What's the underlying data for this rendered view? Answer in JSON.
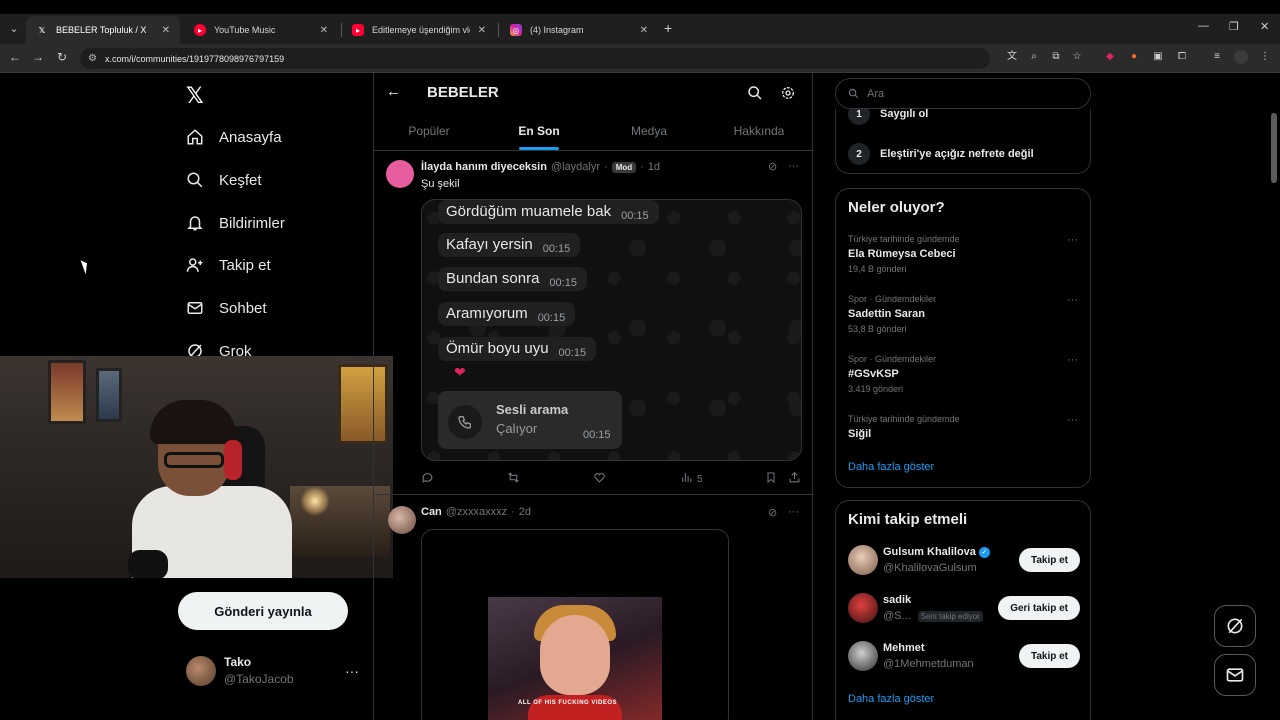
{
  "browser": {
    "tabs": [
      {
        "title": "BEBELER Topluluk / X",
        "favicon": "x-logo",
        "active": true
      },
      {
        "title": "YouTube Music",
        "favicon": "youtube-music-icon",
        "active": false
      },
      {
        "title": "Editlemeye üşendiğim vlog - Yo",
        "favicon": "youtube-icon",
        "active": false
      },
      {
        "title": "(4) Instagram",
        "favicon": "instagram-icon",
        "active": false
      }
    ],
    "url": "x.com/i/communities/1919778098976797159"
  },
  "nav": {
    "items": [
      "Anasayfa",
      "Keşfet",
      "Bildirimler",
      "Takip et",
      "Sohbet",
      "Grok"
    ],
    "post_button": "Gönderi yayınla",
    "profile": {
      "name": "Tako",
      "handle": "@TakoJacob"
    }
  },
  "community": {
    "title": "BEBELER",
    "tabs": [
      "Popüler",
      "En Son",
      "Medya",
      "Hakkında"
    ],
    "active_tab": "En Son"
  },
  "tweets": [
    {
      "name": "İlayda hanım diyeceksin",
      "handle": "@laydalyr",
      "badge": "Mod",
      "sep": "·",
      "time": "1d",
      "text": "Şu şekil",
      "chat": [
        {
          "msg": "Gördüğüm muamele bak",
          "time": "00:15"
        },
        {
          "msg": "Kafayı yersin",
          "time": "00:15"
        },
        {
          "msg": "Bundan sonra",
          "time": "00:15"
        },
        {
          "msg": "Aramıyorum",
          "time": "00:15"
        },
        {
          "msg": "Ömür boyu uyu",
          "time": "00:15"
        }
      ],
      "heart": "❤",
      "call": {
        "title": "Sesli arama",
        "status": "Çalıyor",
        "time": "00:15"
      },
      "views": "5"
    },
    {
      "name": "Can",
      "handle": "@zxxxaxxxz",
      "sep": "·",
      "time": "2d",
      "video_caption": "ALL OF HIS FUCKING VIDEOS"
    }
  ],
  "search": {
    "placeholder": "Ara"
  },
  "rules": [
    {
      "num": "1",
      "text": "Saygılı ol"
    },
    {
      "num": "2",
      "text": "Eleştiri'ye açığız nefrete değil"
    }
  ],
  "trends": {
    "title": "Neler oluyor?",
    "items": [
      {
        "context": "Türkiye tarihinde gündemde",
        "name": "Ela Rümeysa Cebeci",
        "count": "19,4 B gönderi"
      },
      {
        "context": "Spor · Gündemdekiler",
        "name": "Sadettin Saran",
        "count": "53,8 B gönderi"
      },
      {
        "context": "Spor · Gündemdekiler",
        "name": "#GSvKSP",
        "count": "3.419 gönderi"
      },
      {
        "context": "Türkiye tarihinde gündemde",
        "name": "Siğil",
        "count": ""
      }
    ],
    "show_more": "Daha fazla göster"
  },
  "who_to_follow": {
    "title": "Kimi takip etmeli",
    "users": [
      {
        "name": "Gulsum Khalilova",
        "handle": "@KhalilovaGulsum",
        "button": "Takip et",
        "verified": true
      },
      {
        "name": "sadik",
        "handle": "@S...",
        "follows_you": "Seni takip ediyor",
        "button": "Geri takip et"
      },
      {
        "name": "Mehmet",
        "handle": "@1Mehmetduman",
        "button": "Takip et"
      }
    ],
    "show_more": "Daha fazla göster"
  },
  "colors": {
    "accent": "#1d9bf0",
    "background": "#000000",
    "border": "#2f3336",
    "muted": "#71767b"
  }
}
